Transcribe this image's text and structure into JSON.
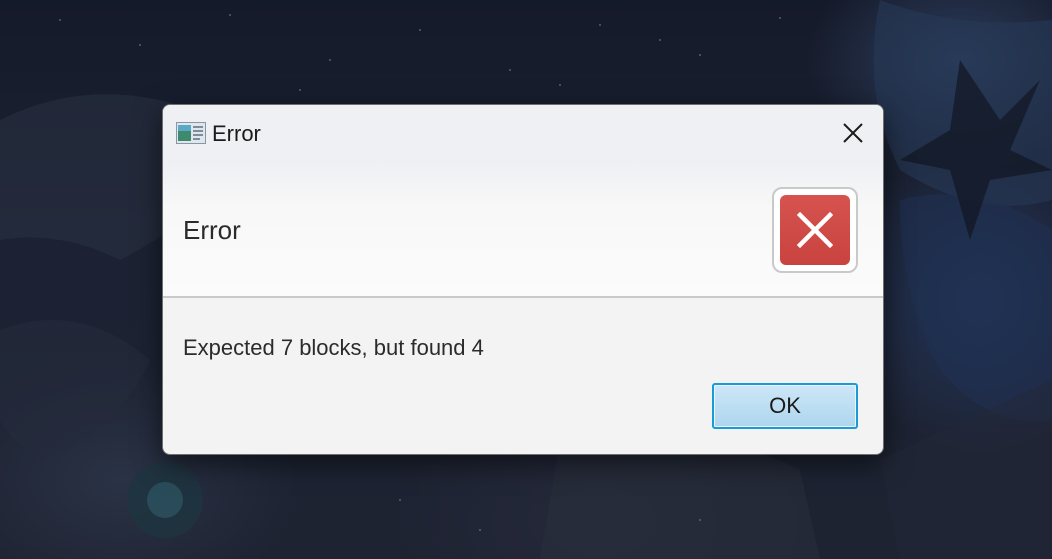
{
  "dialog": {
    "title": "Error",
    "app_icon": "application-window-icon",
    "close_icon": "close-icon",
    "header_text": "Error",
    "status_icon": "error-x-icon",
    "message": "Expected 7 blocks, but found 4",
    "ok_label": "OK"
  },
  "colors": {
    "error_red": "#d0483f",
    "ok_button_border": "#1b9ad6",
    "ok_button_fill": "#bfe0f3"
  }
}
